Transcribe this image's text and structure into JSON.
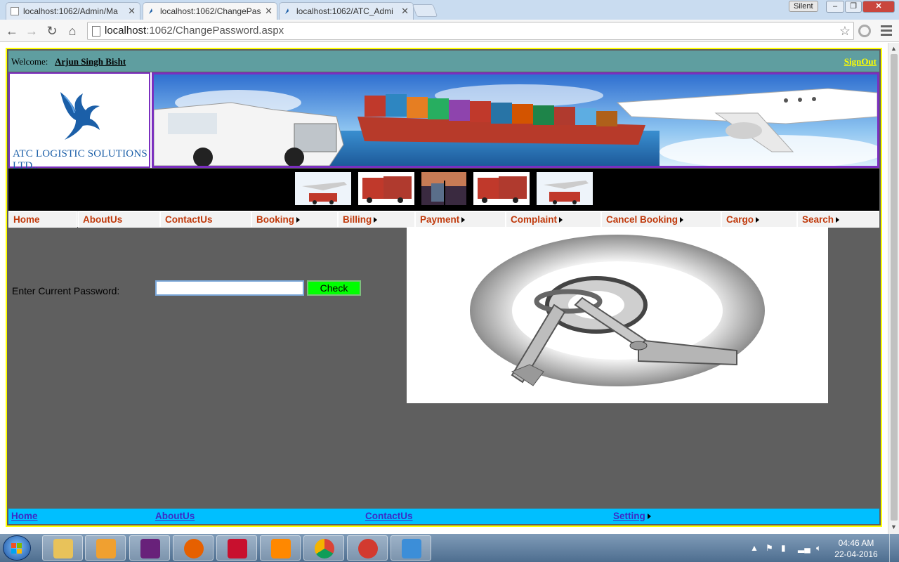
{
  "browser": {
    "tabs": [
      {
        "title": "localhost:1062/Admin/Ma",
        "active": false
      },
      {
        "title": "localhost:1062/ChangePas",
        "active": true
      },
      {
        "title": "localhost:1062/ATC_Admi",
        "active": false
      }
    ],
    "profile_label": "Silent",
    "url_host": "localhost",
    "url_rest": ":1062/ChangePassword.aspx"
  },
  "page": {
    "welcome_label": "Welcome:",
    "user_name": "Arjun Singh Bisht",
    "signout_label": "SignOut",
    "logo_text": "ATC LOGISTIC SOLUTIONS LTD.,",
    "menu": [
      {
        "label": "Home",
        "submenu": false
      },
      {
        "label": "AboutUs",
        "submenu": false
      },
      {
        "label": "ContactUs",
        "submenu": false
      },
      {
        "label": "Booking",
        "submenu": true
      },
      {
        "label": "Billing",
        "submenu": true
      },
      {
        "label": "Payment",
        "submenu": true
      },
      {
        "label": "Complaint",
        "submenu": true
      },
      {
        "label": "Cancel Booking",
        "submenu": true
      },
      {
        "label": "Cargo",
        "submenu": true
      },
      {
        "label": "Search",
        "submenu": true
      }
    ],
    "form": {
      "current_password_label": "Enter Current Password:",
      "current_password_value": "",
      "check_label": "Check"
    },
    "footer": [
      {
        "label": "Home",
        "submenu": false
      },
      {
        "label": "AboutUs",
        "submenu": false
      },
      {
        "label": "ContactUs",
        "submenu": false
      },
      {
        "label": "Setting",
        "submenu": true
      }
    ]
  },
  "taskbar": {
    "time": "04:46 AM",
    "date": "22-04-2016"
  },
  "colors": {
    "menu_text": "#c0390b",
    "welcome_bar": "#5f9ea0",
    "footer_bar": "#00bfff",
    "check_button": "#00ff00",
    "border_accent": "#ffff00"
  }
}
